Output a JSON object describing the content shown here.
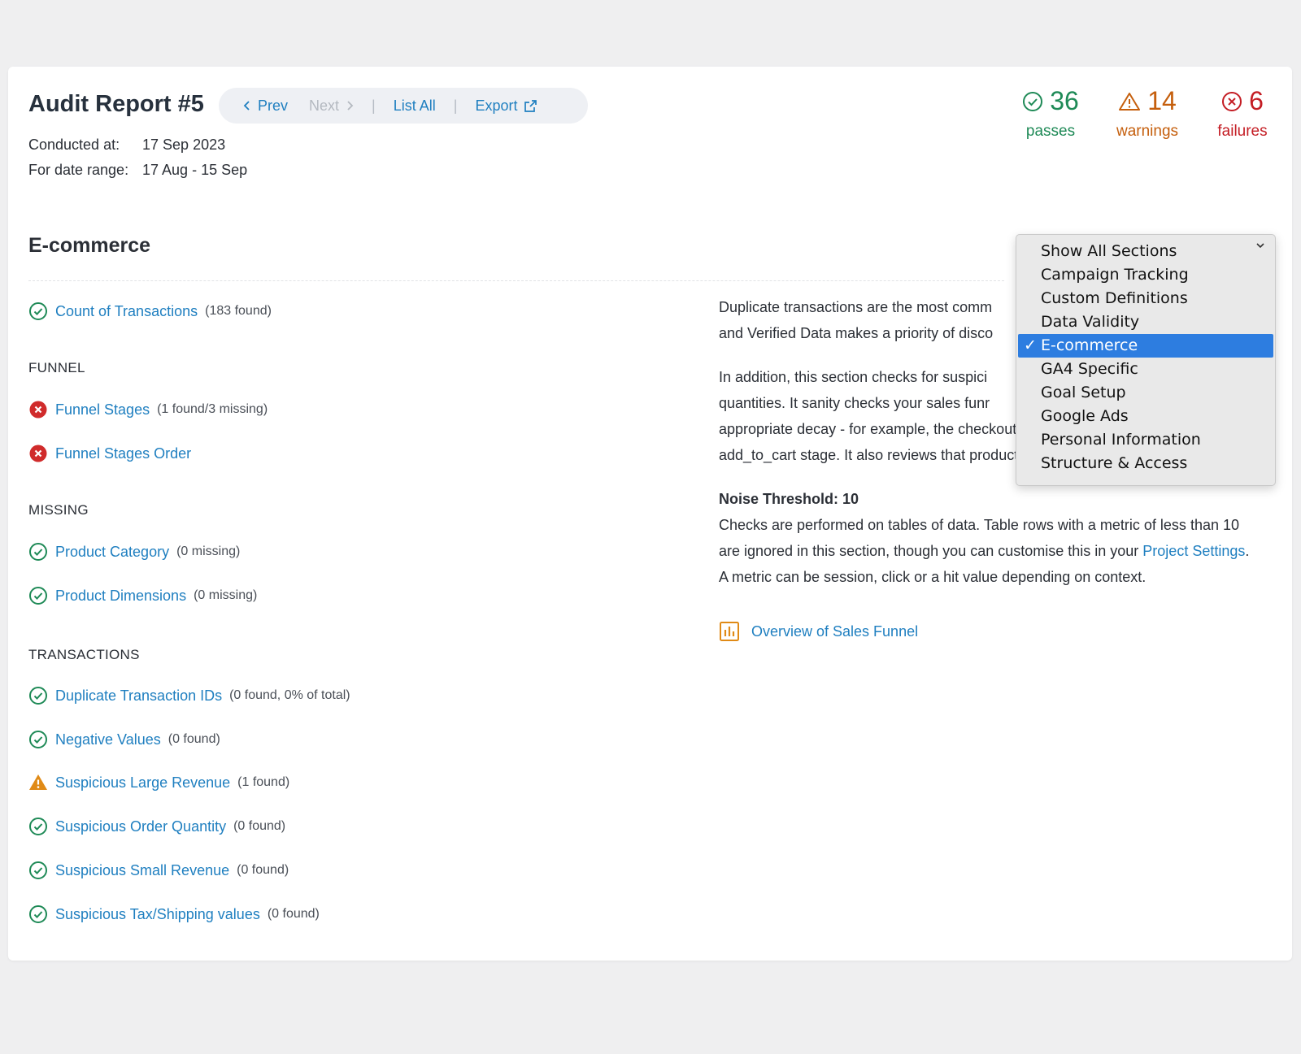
{
  "header": {
    "title": "Audit Report #5",
    "nav": {
      "prev_label": "Prev",
      "next_label": "Next",
      "list_all_label": "List All",
      "export_label": "Export",
      "separator": "|"
    },
    "conducted_label": "Conducted at:",
    "conducted_value": "17 Sep 2023",
    "range_label": "For date range:",
    "range_value": "17 Aug - 15 Sep"
  },
  "stats": {
    "passes": {
      "count": "36",
      "label": "passes",
      "icon": "check-circle-icon",
      "color": "#1f8a57"
    },
    "warnings": {
      "count": "14",
      "label": "warnings",
      "icon": "warning-triangle-icon",
      "color": "#c55f0d"
    },
    "failures": {
      "count": "6",
      "label": "failures",
      "icon": "x-circle-icon",
      "color": "#c41d24"
    }
  },
  "section": {
    "title": "E-commerce"
  },
  "checks": {
    "top": [
      {
        "name": "Count of Transactions",
        "note": "(183 found)",
        "status": "pass"
      }
    ],
    "groups": [
      {
        "heading": "FUNNEL",
        "items": [
          {
            "name": "Funnel Stages",
            "note": "(1 found/3 missing)",
            "status": "fail"
          },
          {
            "name": "Funnel Stages Order",
            "note": "",
            "status": "fail"
          }
        ]
      },
      {
        "heading": "MISSING",
        "items": [
          {
            "name": "Product Category",
            "note": "(0 missing)",
            "status": "pass"
          },
          {
            "name": "Product Dimensions",
            "note": "(0 missing)",
            "status": "pass"
          }
        ]
      },
      {
        "heading": "TRANSACTIONS",
        "items": [
          {
            "name": "Duplicate Transaction IDs",
            "note": "(0 found, 0% of total)",
            "status": "pass"
          },
          {
            "name": "Negative Values",
            "note": "(0 found)",
            "status": "pass"
          },
          {
            "name": "Suspicious Large Revenue",
            "note": "(1 found)",
            "status": "warn"
          },
          {
            "name": "Suspicious Order Quantity",
            "note": "(0 found)",
            "status": "pass"
          },
          {
            "name": "Suspicious Small Revenue",
            "note": "(0 found)",
            "status": "pass"
          },
          {
            "name": "Suspicious Tax/Shipping values",
            "note": "(0 found)",
            "status": "pass"
          }
        ]
      }
    ]
  },
  "description": {
    "p1_l1": "Duplicate transactions are the most comm",
    "p1_l2": "and Verified Data makes a priority of disco",
    "p2_l1": "In addition, this section checks for suspici",
    "p2_l2": "quantities. It sanity checks your sales funr",
    "p2_l3": "appropriate decay - for example, the checkout stage should be less than the",
    "p2_l4": "add_to_cart stage. It also reviews that product dimensions are set.",
    "noise_heading": "Noise Threshold: 10",
    "noise_l1": "Checks are performed on tables of data. Table rows with a metric of less than 10",
    "noise_l2_pre": "are ignored in this section, though you can customise this in your ",
    "noise_l2_link": "Project Settings",
    "noise_l2_post": ".",
    "noise_l3": "A metric can be session, click or a hit value depending on context.",
    "overview_link": "Overview of Sales Funnel"
  },
  "section_select": {
    "selected": "E-commerce",
    "options": [
      "Show All Sections",
      "Campaign Tracking",
      "Custom Definitions",
      "Data Validity",
      "E-commerce",
      "GA4 Specific",
      "Goal Setup",
      "Google Ads",
      "Personal Information",
      "Structure & Access"
    ]
  },
  "colors": {
    "link": "#1f7fc0",
    "pass": "#1f8a57",
    "warn": "#e08a16",
    "fail": "#d02b2b",
    "select_highlight": "#2d7de0"
  }
}
